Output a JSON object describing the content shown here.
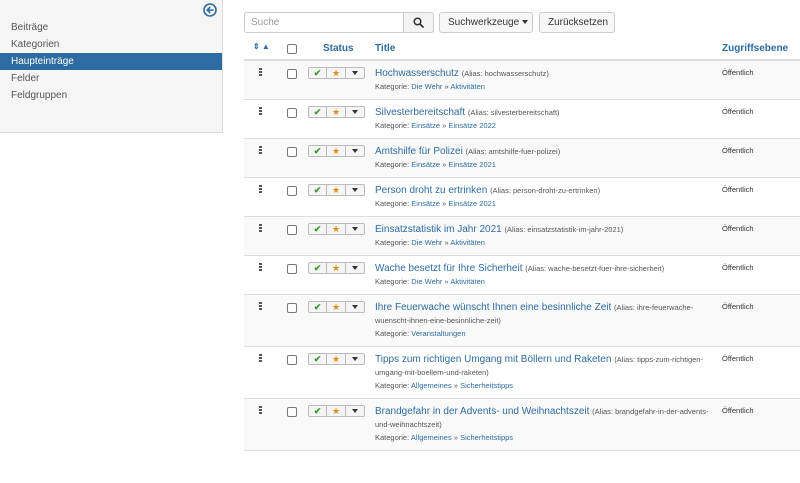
{
  "sidebar": {
    "items": [
      {
        "label": "Beiträge",
        "active": false
      },
      {
        "label": "Kategorien",
        "active": false
      },
      {
        "label": "Haupteinträge",
        "active": true
      },
      {
        "label": "Felder",
        "active": false
      },
      {
        "label": "Feldgruppen",
        "active": false
      }
    ]
  },
  "toolbar": {
    "search_placeholder": "Suche",
    "search_value": "",
    "tools_label": "Suchwerkzeuge",
    "reset_label": "Zurücksetzen"
  },
  "table": {
    "headers": {
      "sort": "⇕ ▲",
      "status": "Status",
      "title": "Title",
      "access": "Zugriffsebene"
    },
    "rows": [
      {
        "title": "Hochwasserschutz",
        "alias": "(Alias: hochwasserschutz)",
        "category_label": "Kategorie:",
        "category": [
          "Die Wehr",
          "Aktivitäten"
        ],
        "access": "Öffentlich"
      },
      {
        "title": "Silvesterbereitschaft",
        "alias": "(Alias: silvesterbereitschaft)",
        "category_label": "Kategorie:",
        "category": [
          "Einsätze",
          "Einsätze 2022"
        ],
        "access": "Öffentlich"
      },
      {
        "title": "Amtshilfe für Polizei",
        "alias": "(Alias: amtshilfe-fuer-polizei)",
        "category_label": "Kategorie:",
        "category": [
          "Einsätze",
          "Einsätze 2021"
        ],
        "access": "Öffentlich"
      },
      {
        "title": "Person droht zu ertrinken",
        "alias": "(Alias: person-droht-zu-ertrinken)",
        "category_label": "Kategorie:",
        "category": [
          "Einsätze",
          "Einsätze 2021"
        ],
        "access": "Öffentlich"
      },
      {
        "title": "Einsatzstatistik im Jahr 2021",
        "alias": "(Alias: einsatzstatistik-im-jahr-2021)",
        "category_label": "Kategorie:",
        "category": [
          "Die Wehr",
          "Aktivitäten"
        ],
        "access": "Öffentlich"
      },
      {
        "title": "Wache besetzt für Ihre Sicherheit",
        "alias": "(Alias: wache-besetzt-fuer-ihre-sicherheit)",
        "category_label": "Kategorie:",
        "category": [
          "Die Wehr",
          "Aktivitäten"
        ],
        "access": "Öffentlich"
      },
      {
        "title": "Ihre Feuerwache wünscht Ihnen eine besinnliche Zeit",
        "alias": "(Alias: ihre-feuerwache-wuenscht-ihnen-eine-besinnliche-zeit)",
        "category_label": "Kategorie:",
        "category": [
          "Veranstaltungen"
        ],
        "access": "Öffentlich"
      },
      {
        "title": "Tipps zum richtigen Umgang mit Böllern und Raketen",
        "alias": "(Alias: tipps-zum-richtigen-umgang-mit-boellern-und-raketen)",
        "category_label": "Kategorie:",
        "category": [
          "Allgemeines",
          "Sicherheitstipps"
        ],
        "access": "Öffentlich"
      },
      {
        "title": "Brandgefahr in der Advents- und Weihnachtszeit",
        "alias": "(Alias: brandgefahr-in-der-advents-und-weihnachtszeit)",
        "category_label": "Kategorie:",
        "category": [
          "Allgemeines",
          "Sicherheitstipps"
        ],
        "access": "Öffentlich"
      }
    ]
  },
  "colors": {
    "accent": "#2d6ca2",
    "published": "#3c9a2e",
    "featured": "#e08e0b"
  },
  "icons": [
    "collapse-left-icon",
    "search-icon",
    "drag-handle-icon",
    "check-icon",
    "star-icon",
    "caret-down-icon"
  ]
}
